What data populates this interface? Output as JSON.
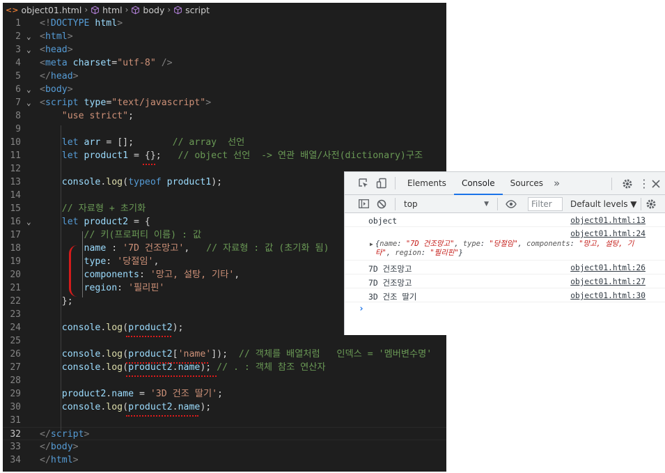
{
  "editor": {
    "breadcrumb": {
      "file": "object01.html",
      "items": [
        "html",
        "body",
        "script"
      ]
    },
    "lines": [
      {
        "n": "1",
        "fold": "",
        "tokens": [
          [
            "t-punc",
            "<!"
          ],
          [
            "t-tag",
            "DOCTYPE"
          ],
          [
            "t-white",
            " "
          ],
          [
            "t-attr",
            "html"
          ],
          [
            "t-punc",
            ">"
          ]
        ]
      },
      {
        "n": "2",
        "fold": "v",
        "tokens": [
          [
            "t-punc",
            "<"
          ],
          [
            "t-tag",
            "html"
          ],
          [
            "t-punc",
            ">"
          ]
        ]
      },
      {
        "n": "3",
        "fold": "v",
        "tokens": [
          [
            "t-punc",
            "<"
          ],
          [
            "t-tag",
            "head"
          ],
          [
            "t-punc",
            ">"
          ]
        ]
      },
      {
        "n": "4",
        "fold": "",
        "tokens": [
          [
            "t-punc",
            "<"
          ],
          [
            "t-tag",
            "meta"
          ],
          [
            "t-white",
            " "
          ],
          [
            "t-attr",
            "charset"
          ],
          [
            "t-white",
            "="
          ],
          [
            "t-str",
            "\"utf-8\""
          ],
          [
            "t-white",
            " "
          ],
          [
            "t-punc",
            "/>"
          ]
        ]
      },
      {
        "n": "5",
        "fold": "",
        "tokens": [
          [
            "t-punc",
            "</"
          ],
          [
            "t-tag",
            "head"
          ],
          [
            "t-punc",
            ">"
          ]
        ]
      },
      {
        "n": "6",
        "fold": "v",
        "tokens": [
          [
            "t-punc",
            "<"
          ],
          [
            "t-tag",
            "body"
          ],
          [
            "t-punc",
            ">"
          ]
        ]
      },
      {
        "n": "7",
        "fold": "v",
        "tokens": [
          [
            "t-punc",
            "<"
          ],
          [
            "t-tag",
            "script"
          ],
          [
            "t-white",
            " "
          ],
          [
            "t-attr",
            "type"
          ],
          [
            "t-white",
            "="
          ],
          [
            "t-str",
            "\"text/javascript\""
          ],
          [
            "t-punc",
            ">"
          ]
        ]
      },
      {
        "n": "8",
        "fold": "",
        "tokens": [
          [
            "t-white",
            "    "
          ],
          [
            "t-str",
            "\"use strict\""
          ],
          [
            "t-white",
            ";"
          ]
        ]
      },
      {
        "n": "9",
        "fold": "",
        "tokens": []
      },
      {
        "n": "10",
        "fold": "",
        "tokens": [
          [
            "t-white",
            "    "
          ],
          [
            "t-kw",
            "let"
          ],
          [
            "t-white",
            " "
          ],
          [
            "t-var",
            "arr"
          ],
          [
            "t-white",
            " = [];       "
          ],
          [
            "t-cmt",
            "// array  선언"
          ]
        ]
      },
      {
        "n": "11",
        "fold": "",
        "tokens": [
          [
            "t-white",
            "    "
          ],
          [
            "t-kw",
            "let"
          ],
          [
            "t-white",
            " "
          ],
          [
            "t-var",
            "product1"
          ],
          [
            "t-white",
            " = {};   "
          ],
          [
            "t-cmt",
            "// object 선언  -> 연관 배열/사전(dictionary)구조"
          ]
        ]
      },
      {
        "n": "12",
        "fold": "",
        "tokens": []
      },
      {
        "n": "13",
        "fold": "",
        "tokens": [
          [
            "t-white",
            "    "
          ],
          [
            "t-var",
            "console"
          ],
          [
            "t-white",
            "."
          ],
          [
            "t-fn",
            "log"
          ],
          [
            "t-white",
            "("
          ],
          [
            "t-kw",
            "typeof"
          ],
          [
            "t-white",
            " "
          ],
          [
            "t-var",
            "product1"
          ],
          [
            "t-white",
            ");"
          ]
        ]
      },
      {
        "n": "14",
        "fold": "",
        "tokens": []
      },
      {
        "n": "15",
        "fold": "",
        "tokens": [
          [
            "t-white",
            "    "
          ],
          [
            "t-cmt",
            "// 자료형 + 초기화"
          ]
        ]
      },
      {
        "n": "16",
        "fold": "v",
        "tokens": [
          [
            "t-white",
            "    "
          ],
          [
            "t-kw",
            "let"
          ],
          [
            "t-white",
            " "
          ],
          [
            "t-var",
            "product2"
          ],
          [
            "t-white",
            " = {"
          ]
        ]
      },
      {
        "n": "17",
        "fold": "",
        "tokens": [
          [
            "t-white",
            "        "
          ],
          [
            "t-cmt",
            "// 키(프로퍼티 이름) : 값"
          ]
        ]
      },
      {
        "n": "18",
        "fold": "",
        "tokens": [
          [
            "t-white",
            "        "
          ],
          [
            "t-prop",
            "name"
          ],
          [
            "t-white",
            " : "
          ],
          [
            "t-str",
            "'7D 건조망고'"
          ],
          [
            "t-white",
            ",   "
          ],
          [
            "t-cmt",
            "// 자료형 : 값 (초기화 됨)"
          ]
        ]
      },
      {
        "n": "19",
        "fold": "",
        "tokens": [
          [
            "t-white",
            "        "
          ],
          [
            "t-prop",
            "type"
          ],
          [
            "t-white",
            ": "
          ],
          [
            "t-str",
            "'당절임'"
          ],
          [
            "t-white",
            ","
          ]
        ]
      },
      {
        "n": "20",
        "fold": "",
        "tokens": [
          [
            "t-white",
            "        "
          ],
          [
            "t-prop",
            "components"
          ],
          [
            "t-white",
            ": "
          ],
          [
            "t-str",
            "'망고, 설탕, 기타'"
          ],
          [
            "t-white",
            ","
          ]
        ]
      },
      {
        "n": "21",
        "fold": "",
        "tokens": [
          [
            "t-white",
            "        "
          ],
          [
            "t-prop",
            "region"
          ],
          [
            "t-white",
            ": "
          ],
          [
            "t-str",
            "'필리핀'"
          ]
        ]
      },
      {
        "n": "22",
        "fold": "",
        "tokens": [
          [
            "t-white",
            "    };"
          ]
        ]
      },
      {
        "n": "23",
        "fold": "",
        "tokens": []
      },
      {
        "n": "24",
        "fold": "",
        "tokens": [
          [
            "t-white",
            "    "
          ],
          [
            "t-var",
            "console"
          ],
          [
            "t-white",
            "."
          ],
          [
            "t-fn",
            "log"
          ],
          [
            "t-white",
            "("
          ],
          [
            "t-var",
            "product2"
          ],
          [
            "t-white",
            ");"
          ]
        ]
      },
      {
        "n": "25",
        "fold": "",
        "tokens": []
      },
      {
        "n": "26",
        "fold": "",
        "tokens": [
          [
            "t-white",
            "    "
          ],
          [
            "t-var",
            "console"
          ],
          [
            "t-white",
            "."
          ],
          [
            "t-fn",
            "log"
          ],
          [
            "t-white",
            "("
          ],
          [
            "t-var",
            "product2"
          ],
          [
            "t-white",
            "["
          ],
          [
            "t-str",
            "'name'"
          ],
          [
            "t-white",
            "]);  "
          ],
          [
            "t-cmt",
            "// 객체를 배열처럼   인덱스 = '멤버변수명'"
          ]
        ]
      },
      {
        "n": "27",
        "fold": "",
        "tokens": [
          [
            "t-white",
            "    "
          ],
          [
            "t-var",
            "console"
          ],
          [
            "t-white",
            "."
          ],
          [
            "t-fn",
            "log"
          ],
          [
            "t-white",
            "("
          ],
          [
            "t-var",
            "product2"
          ],
          [
            "t-white",
            "."
          ],
          [
            "t-var",
            "name"
          ],
          [
            "t-white",
            "); "
          ],
          [
            "t-cmt",
            "// . : 객체 참조 연산자"
          ]
        ]
      },
      {
        "n": "28",
        "fold": "",
        "tokens": []
      },
      {
        "n": "29",
        "fold": "",
        "tokens": [
          [
            "t-white",
            "    "
          ],
          [
            "t-var",
            "product2"
          ],
          [
            "t-white",
            "."
          ],
          [
            "t-var",
            "name"
          ],
          [
            "t-white",
            " = "
          ],
          [
            "t-str",
            "'3D 건조 딸기'"
          ],
          [
            "t-white",
            ";"
          ]
        ]
      },
      {
        "n": "30",
        "fold": "",
        "tokens": [
          [
            "t-white",
            "    "
          ],
          [
            "t-var",
            "console"
          ],
          [
            "t-white",
            "."
          ],
          [
            "t-fn",
            "log"
          ],
          [
            "t-white",
            "("
          ],
          [
            "t-var",
            "product2"
          ],
          [
            "t-white",
            "."
          ],
          [
            "t-var",
            "name"
          ],
          [
            "t-white",
            ");"
          ]
        ]
      },
      {
        "n": "31",
        "fold": "",
        "tokens": []
      },
      {
        "n": "32",
        "fold": "",
        "tokens": [
          [
            "t-punc",
            "</"
          ],
          [
            "t-tag",
            "script"
          ],
          [
            "t-punc",
            ">"
          ]
        ]
      },
      {
        "n": "33",
        "fold": "",
        "tokens": [
          [
            "t-punc",
            "</"
          ],
          [
            "t-tag",
            "body"
          ],
          [
            "t-punc",
            ">"
          ]
        ]
      },
      {
        "n": "34",
        "fold": "",
        "tokens": [
          [
            "t-punc",
            "</"
          ],
          [
            "t-tag",
            "html"
          ],
          [
            "t-punc",
            ">"
          ]
        ]
      }
    ]
  },
  "devtools": {
    "tabs": [
      "Elements",
      "Console",
      "Sources"
    ],
    "active_tab": "Console",
    "more_tabs": "»",
    "context": "top",
    "filter_placeholder": "Filter",
    "levels_label": "Default levels ▼",
    "messages": [
      {
        "text": "object",
        "link": "object01.html:13"
      },
      {
        "text": "",
        "link": "object01.html:24"
      },
      {
        "text": "7D 건조망고",
        "link": "object01.html:26"
      },
      {
        "text": "7D 건조망고",
        "link": "object01.html:27"
      },
      {
        "text": "3D 건조 딸기",
        "link": "object01.html:30"
      }
    ],
    "object_preview": {
      "open": "{",
      "pairs": [
        {
          "k": "name",
          "v": "\"7D 건조망고\""
        },
        {
          "k": "type",
          "v": "\"당절임\""
        },
        {
          "k": "components",
          "v": "\"망고, 설탕, 기타\""
        },
        {
          "k": "region",
          "v": "\"필리핀\""
        }
      ],
      "close": "}"
    },
    "prompt": "›"
  }
}
